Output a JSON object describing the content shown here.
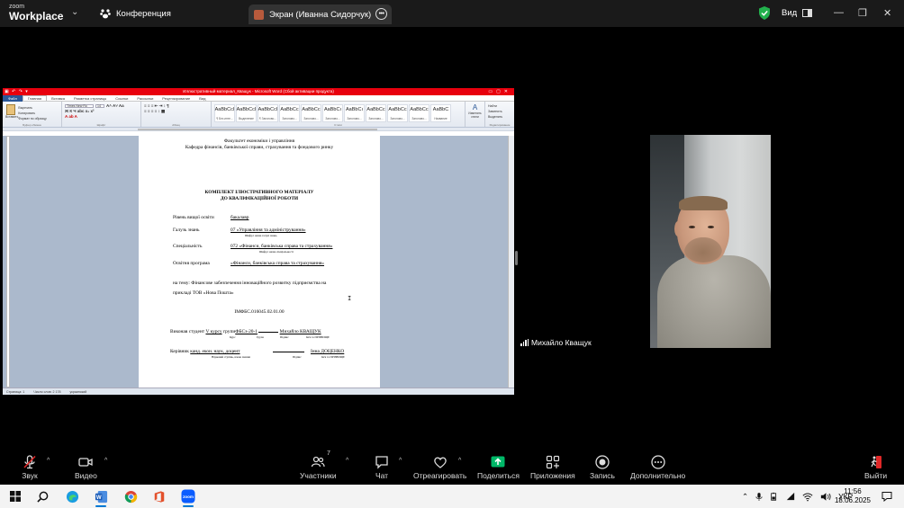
{
  "app": {
    "logo_line1": "zoom",
    "logo_line2": "Workplace",
    "meeting_menu": "Конференция",
    "screen_tab": "Экран (Иванна Сидорчук)",
    "view_label": "Вид"
  },
  "word": {
    "title": "Иллюстративный материал_Кващук - Microsoft Word (Сбой активации продукта)",
    "tabs": [
      "Файл",
      "Главная",
      "Вставка",
      "Разметка страницы",
      "Ссылки",
      "Рассылки",
      "Рецензирование",
      "Вид"
    ],
    "font_name": "Times New Ro",
    "font_size": "14",
    "clipboard_items": [
      "Вырезать",
      "Копировать",
      "Формат по образцу"
    ],
    "paste_label": "Вставить",
    "styles": [
      {
        "sample": "AaBbCcI",
        "name": "¶ Без инте..."
      },
      {
        "sample": "AaBbCcI",
        "name": "Выделение"
      },
      {
        "sample": "AaBbCcI",
        "name": "¶ Заголово..."
      },
      {
        "sample": "AaBbCc",
        "name": "Заголово..."
      },
      {
        "sample": "AaBbCc",
        "name": "Заголово..."
      },
      {
        "sample": "AaBbCı",
        "name": "Заголово..."
      },
      {
        "sample": "AaBbCı",
        "name": "Заголово..."
      },
      {
        "sample": "AaBbCc",
        "name": "Заголово..."
      },
      {
        "sample": "AaBbCc",
        "name": "Заголово..."
      },
      {
        "sample": "AaBbCc",
        "name": "Заголово..."
      },
      {
        "sample": "AaBbC",
        "name": "Название"
      }
    ],
    "change_styles": "Изменить стили",
    "edit_items": [
      "Найти",
      "Заменить",
      "Выделить"
    ],
    "group_labels": [
      "Буфер обмена",
      "Шрифт",
      "Абзац",
      "Стили",
      "Редактирование"
    ],
    "status": [
      "Страница: 1",
      "Число слов: 2 178",
      "украинский"
    ]
  },
  "doc": {
    "faculty": "Факультет економіки і управління",
    "department": "Кафедра фінансів, банківської справи, страхування та фондового ринку",
    "heading1": "КОМПЛЕКТ ІЛЮСТРАТИВНОГО МАТЕРІАЛУ",
    "heading2": "ДО КВАЛІФІКАЦІЙНОЇ РОБОТИ",
    "level_label": "Рівень вищої освіти",
    "level_value": "бакалавр",
    "branch_label": "Галузь знань",
    "branch_value": "07 «Управління та адміністрування»",
    "branch_hint": "Шифр і назва галузі знань",
    "spec_label": "Спеціальність",
    "spec_value": "072 «Фінанси, банківська справа та страхування»",
    "spec_hint": "Шифр і назва спеціальності",
    "program_label": "Освітня програма",
    "program_value": "«Фінанси, банківська справа та страхування»",
    "topic_line1": "на тему: Фінансове забезпечення інноваційного розвитку підприємства на",
    "topic_line2": "прикладі ТОВ «Нова Пошта»",
    "code": "ІМФБС.016045.02.01.00",
    "student_prefix": "Виконав студент",
    "student_course": "V курсу",
    "student_group_prefix": "групи",
    "student_group": "ФБСз-20-1",
    "student_name": "Михайло КВАЩУК",
    "student_hints": [
      "Курс",
      "Група",
      "Підпис",
      "Ім'я та ПРІЗВИЩЕ"
    ],
    "supervisor_prefix": "Керівник",
    "supervisor_title": "канд. екон. наук, доцент",
    "supervisor_name": "Інна ДОЦЕНКО",
    "supervisor_hints": [
      "Науковий ступінь, вчене звання",
      "Підпис",
      "Ім'я та ПРІЗВИЩЕ"
    ]
  },
  "participant": {
    "name": "Михайло Кващук"
  },
  "controls": {
    "audio": "Звук",
    "video": "Видео",
    "participants": "Участники",
    "participants_count": "7",
    "chat": "Чат",
    "react": "Отреагировать",
    "share": "Поделиться",
    "apps": "Приложения",
    "record": "Запись",
    "more": "Дополнительно",
    "leave": "Выйти"
  },
  "taskbar": {
    "language": "УКР",
    "time": "11:56",
    "date": "18.06.2025"
  },
  "colors": {
    "share_green": "#00b868",
    "word_title_red": "#e8000d",
    "shield_green": "#22b14c"
  }
}
